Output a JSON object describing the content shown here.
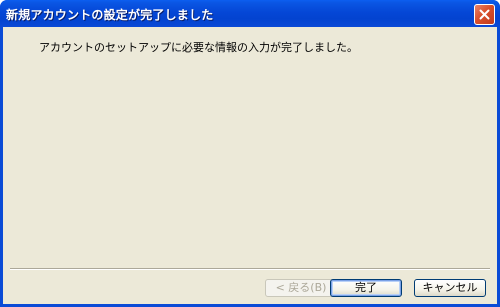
{
  "window": {
    "title": "新規アカウントの設定が完了しました"
  },
  "content": {
    "message": "アカウントのセットアップに必要な情報の入力が完了しました。"
  },
  "buttons": {
    "back": "< 戻る(B)",
    "finish": "完了",
    "cancel": "キャンセル"
  },
  "icons": {
    "close": "close-icon"
  },
  "colors": {
    "titlebar": "#0547d6",
    "client": "#ece9d8",
    "close_button": "#d9502c"
  }
}
